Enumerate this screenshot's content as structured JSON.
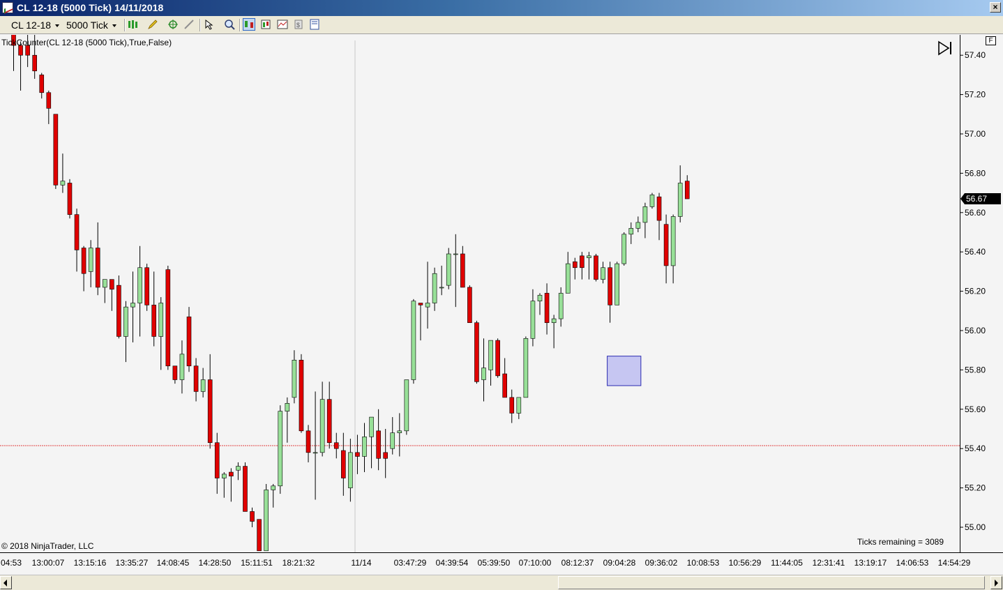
{
  "window": {
    "title": "CL 12-18 (5000 Tick)  14/11/2018"
  },
  "toolbar": {
    "instrument": "CL 12-18",
    "interval": "5000 Tick"
  },
  "chart": {
    "indicator_label": "TickCounter(CL  12-18  (5000  Tick),True,False)",
    "copyright": "© 2018 NinjaTrader, LLC",
    "ticks_remaining": "Ticks remaining = 3089",
    "f_button": "F",
    "last_price": "56.67"
  },
  "colors": {
    "up": "#98e098",
    "down": "#e00000",
    "wick": "#000000",
    "marker_line": "#e04040",
    "box": "#c6c6f2",
    "box_border": "#2a2ab0"
  },
  "chart_data": {
    "type": "candlestick",
    "title": "",
    "xlabel": "",
    "ylabel": "",
    "ylim": [
      54.88,
      57.5
    ],
    "y_ticks": [
      57.4,
      57.2,
      57.0,
      56.8,
      56.6,
      56.4,
      56.2,
      56.0,
      55.8,
      55.6,
      55.4,
      55.2,
      55.0
    ],
    "x_tick_labels": [
      "04:53",
      "13:00:07",
      "13:15:16",
      "13:35:27",
      "14:08:45",
      "14:28:50",
      "15:11:51",
      "18:21:32",
      "11/14",
      "03:47:29",
      "04:39:54",
      "05:39:50",
      "07:10:00",
      "08:12:37",
      "09:04:28",
      "09:36:02",
      "10:08:53",
      "10:56:29",
      "11:44:05",
      "12:31:41",
      "13:19:17",
      "14:06:53",
      "14:54:29"
    ],
    "horizontal_line": 55.415,
    "grid": false,
    "candles": [
      [
        57.55,
        57.55,
        57.32,
        57.45
      ],
      [
        57.45,
        57.47,
        57.22,
        57.4
      ],
      [
        57.45,
        57.55,
        57.34,
        57.4
      ],
      [
        57.4,
        57.55,
        57.28,
        57.32
      ],
      [
        57.3,
        57.31,
        57.18,
        57.21
      ],
      [
        57.21,
        57.22,
        57.05,
        57.13
      ],
      [
        57.1,
        57.1,
        56.72,
        56.74
      ],
      [
        56.74,
        56.9,
        56.7,
        56.76
      ],
      [
        56.75,
        56.77,
        56.57,
        56.59
      ],
      [
        56.59,
        56.62,
        56.3,
        56.41
      ],
      [
        56.42,
        56.43,
        56.2,
        56.29
      ],
      [
        56.3,
        56.46,
        56.22,
        56.42
      ],
      [
        56.42,
        56.55,
        56.18,
        56.22
      ],
      [
        56.22,
        56.25,
        56.14,
        56.26
      ],
      [
        56.26,
        56.26,
        56.1,
        56.21
      ],
      [
        56.23,
        56.28,
        55.96,
        55.97
      ],
      [
        55.97,
        56.15,
        55.84,
        56.12
      ],
      [
        56.12,
        56.3,
        55.94,
        56.14
      ],
      [
        56.14,
        56.43,
        55.97,
        56.32
      ],
      [
        56.32,
        56.34,
        56.1,
        56.13
      ],
      [
        56.13,
        56.3,
        55.92,
        55.97
      ],
      [
        55.97,
        56.17,
        55.8,
        56.14
      ],
      [
        56.31,
        56.33,
        55.8,
        55.82
      ],
      [
        55.82,
        55.82,
        55.73,
        55.75
      ],
      [
        55.75,
        55.95,
        55.68,
        55.88
      ],
      [
        56.07,
        56.12,
        55.79,
        55.82
      ],
      [
        55.82,
        55.86,
        55.64,
        55.69
      ],
      [
        55.69,
        55.81,
        55.66,
        55.75
      ],
      [
        55.75,
        55.88,
        55.4,
        55.43
      ],
      [
        55.43,
        55.48,
        55.17,
        55.25
      ],
      [
        55.25,
        55.28,
        55.15,
        55.27
      ],
      [
        55.28,
        55.3,
        55.13,
        55.26
      ],
      [
        55.29,
        55.33,
        55.24,
        55.31
      ],
      [
        55.31,
        55.33,
        55.08,
        55.08
      ],
      [
        55.08,
        55.1,
        55.0,
        55.03
      ],
      [
        55.04,
        55.04,
        54.88,
        54.88
      ],
      [
        54.88,
        55.22,
        54.88,
        55.19
      ],
      [
        55.19,
        55.22,
        55.1,
        55.21
      ],
      [
        55.21,
        55.62,
        55.17,
        55.59
      ],
      [
        55.59,
        55.66,
        55.43,
        55.63
      ],
      [
        55.66,
        55.9,
        55.63,
        55.85
      ],
      [
        55.85,
        55.88,
        55.48,
        55.49
      ],
      [
        55.49,
        55.52,
        55.33,
        55.38
      ],
      [
        55.38,
        55.69,
        55.14,
        55.38
      ],
      [
        55.38,
        55.74,
        55.36,
        55.65
      ],
      [
        55.65,
        55.74,
        55.4,
        55.43
      ],
      [
        55.43,
        55.48,
        55.35,
        55.4
      ],
      [
        55.39,
        55.48,
        55.16,
        55.25
      ],
      [
        55.2,
        55.45,
        55.13,
        55.38
      ],
      [
        55.38,
        55.47,
        55.27,
        55.36
      ],
      [
        55.36,
        55.53,
        55.28,
        55.46
      ],
      [
        55.46,
        55.56,
        55.3,
        55.56
      ],
      [
        55.49,
        55.6,
        55.29,
        55.35
      ],
      [
        55.38,
        55.5,
        55.25,
        55.35
      ],
      [
        55.4,
        55.56,
        55.37,
        55.48
      ],
      [
        55.48,
        55.58,
        55.36,
        55.49
      ],
      [
        55.49,
        55.75,
        55.47,
        55.75
      ],
      [
        55.75,
        56.16,
        55.73,
        56.15
      ],
      [
        56.14,
        56.13,
        55.95,
        56.13
      ],
      [
        56.12,
        56.35,
        56.01,
        56.14
      ],
      [
        56.14,
        56.32,
        56.1,
        56.29
      ],
      [
        56.22,
        56.33,
        56.18,
        56.22
      ],
      [
        56.23,
        56.42,
        56.21,
        56.39
      ],
      [
        56.39,
        56.49,
        56.12,
        56.39
      ],
      [
        56.39,
        56.43,
        56.22,
        56.22
      ],
      [
        56.22,
        56.23,
        56.04,
        56.04
      ],
      [
        56.04,
        56.05,
        55.73,
        55.74
      ],
      [
        55.75,
        55.96,
        55.64,
        55.81
      ],
      [
        55.8,
        55.94,
        55.72,
        55.95
      ],
      [
        55.95,
        55.96,
        55.76,
        55.77
      ],
      [
        55.78,
        55.86,
        55.66,
        55.66
      ],
      [
        55.66,
        55.7,
        55.53,
        55.58
      ],
      [
        55.58,
        55.66,
        55.55,
        55.66
      ],
      [
        55.66,
        55.97,
        55.66,
        55.96
      ],
      [
        55.96,
        56.21,
        55.92,
        56.15
      ],
      [
        56.15,
        56.19,
        56.08,
        56.18
      ],
      [
        56.19,
        56.24,
        55.98,
        56.04
      ],
      [
        56.04,
        56.08,
        55.91,
        56.06
      ],
      [
        56.06,
        56.22,
        56.02,
        56.19
      ],
      [
        56.19,
        56.4,
        56.2,
        56.34
      ],
      [
        56.35,
        56.37,
        56.26,
        56.32
      ],
      [
        56.38,
        56.4,
        56.26,
        56.32
      ],
      [
        56.37,
        56.4,
        56.26,
        56.38
      ],
      [
        56.38,
        56.39,
        56.25,
        56.26
      ],
      [
        56.26,
        56.35,
        56.24,
        56.32
      ],
      [
        56.32,
        56.35,
        56.04,
        56.13
      ],
      [
        56.13,
        56.35,
        56.13,
        56.34
      ],
      [
        56.34,
        56.5,
        56.33,
        56.49
      ],
      [
        56.49,
        56.55,
        56.44,
        56.52
      ],
      [
        56.52,
        56.58,
        56.5,
        56.55
      ],
      [
        56.55,
        56.65,
        56.47,
        56.63
      ],
      [
        56.63,
        56.7,
        56.62,
        56.69
      ],
      [
        56.68,
        56.7,
        56.46,
        56.56
      ],
      [
        56.54,
        56.59,
        56.24,
        56.33
      ],
      [
        56.33,
        56.59,
        56.24,
        56.58
      ],
      [
        56.58,
        56.84,
        56.55,
        56.75
      ],
      [
        56.76,
        56.79,
        56.67,
        56.67
      ]
    ],
    "annotations": [
      {
        "type": "rectangle",
        "y_top": 55.87,
        "y_bottom": 55.72,
        "x_start_index": 85,
        "x_end_index": 89
      }
    ]
  }
}
